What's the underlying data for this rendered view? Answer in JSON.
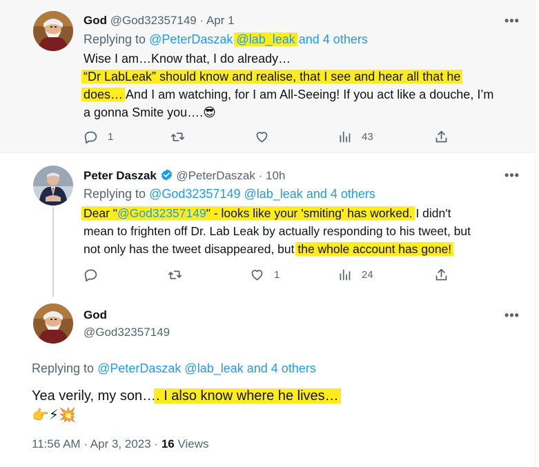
{
  "tweet1": {
    "name": "God",
    "handle": "@God32357149",
    "dot": "·",
    "date": "Apr 1",
    "replying_prefix": "Replying to",
    "reply_mention1": "@PeterDaszak",
    "reply_mention2": "@lab_leak",
    "reply_others": "and 4 others",
    "line1": "Wise I am…Know that, I do already…",
    "line2": "“Dr LabLeak” should know and realise, that I see and hear all that he",
    "line3_hl": "does…",
    "line3_rest": " And I am watching, for I am All-Seeing! If you act like a douche, I’m",
    "line4": "a gonna Smite you….",
    "emoji": "😎",
    "replies": "1",
    "retweets": "",
    "likes": "",
    "views": "43",
    "more": "•••"
  },
  "tweet2": {
    "name": "Peter Daszak",
    "handle": "@PeterDaszak",
    "dot": "·",
    "date": "10h",
    "replying_prefix": "Replying to",
    "reply_mention1": "@God32357149",
    "reply_mention2": "@lab_leak",
    "reply_others": "and 4 others",
    "line1_hl_a": "Dear \"",
    "line1_mention": "@God32357149",
    "line1_hl_b": "\" - looks like your 'smiting' has worked.",
    "line1_rest": " I didn't",
    "line2": "mean to frighten off Dr. Lab Leak by actually responding to his tweet, but",
    "line3_pre": "not only has the tweet disappeared, but ",
    "line3_hl": "the whole account has gone!",
    "replies": "",
    "retweets": "",
    "likes": "1",
    "views": "24",
    "more": "•••"
  },
  "tweet3": {
    "name": "God",
    "handle": "@God32357149",
    "replying_prefix": "Replying to",
    "reply_mention1": "@PeterDaszak",
    "reply_mention2": "@lab_leak",
    "reply_others": "and 4 others",
    "text_pre": "Yea verily, my son…",
    "text_hl": ". I also know where he lives…",
    "emojis": "👉⚡💥",
    "time": "11:56 AM",
    "dot": "·",
    "date": "Apr 3, 2023",
    "dot2": "·",
    "views_count": "16",
    "views_label": "Views",
    "more": "•••"
  },
  "colors": {
    "highlight": "#ffec1a",
    "link": "#1d9bf0",
    "secondary_text": "#536471",
    "verified": "#1d9bf0"
  }
}
